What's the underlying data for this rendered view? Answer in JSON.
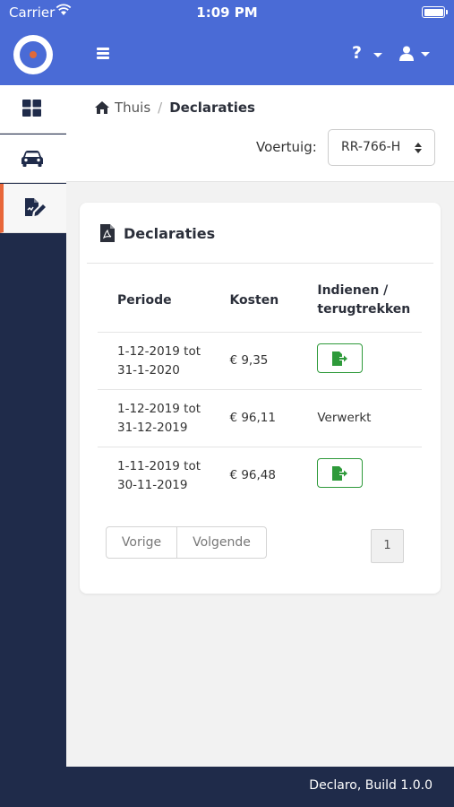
{
  "status_bar": {
    "carrier": "Carrier",
    "time": "1:09 PM"
  },
  "topbar": {
    "help_icon": "question-icon",
    "user_icon": "user-icon",
    "menu_icon": "hamburger-icon"
  },
  "sidebar": {
    "items": [
      {
        "icon": "dashboard-icon",
        "active": false
      },
      {
        "icon": "car-icon",
        "active": false
      },
      {
        "icon": "declaration-icon",
        "active": true
      }
    ]
  },
  "breadcrumb": {
    "home": "Thuis",
    "separator": "/",
    "current": "Declaraties"
  },
  "vehicle": {
    "label": "Voertuig:",
    "selected": "RR-766-H"
  },
  "card": {
    "title": "Declaraties",
    "columns": [
      "Periode",
      "Kosten",
      "Indienen / terugtrekken"
    ],
    "rows": [
      {
        "period_line1": "1-12-2019 tot",
        "period_line2": "31-1-2020",
        "cost": "€ 9,35",
        "action": "submit",
        "status": ""
      },
      {
        "period_line1": "1-12-2019 tot",
        "period_line2": "31-12-2019",
        "cost": "€ 96,11",
        "action": "status",
        "status": "Verwerkt"
      },
      {
        "period_line1": "1-11-2019 tot",
        "period_line2": "30-11-2019",
        "cost": "€ 96,48",
        "action": "submit",
        "status": ""
      }
    ]
  },
  "pager": {
    "prev": "Vorige",
    "next": "Volgende",
    "page": "1"
  },
  "footer": {
    "text": "Declaro, Build 1.0.0"
  },
  "colors": {
    "primary": "#4a6bd6",
    "sidebar": "#1f2b4a",
    "accent": "#e8673a",
    "success": "#2e9a3a"
  }
}
